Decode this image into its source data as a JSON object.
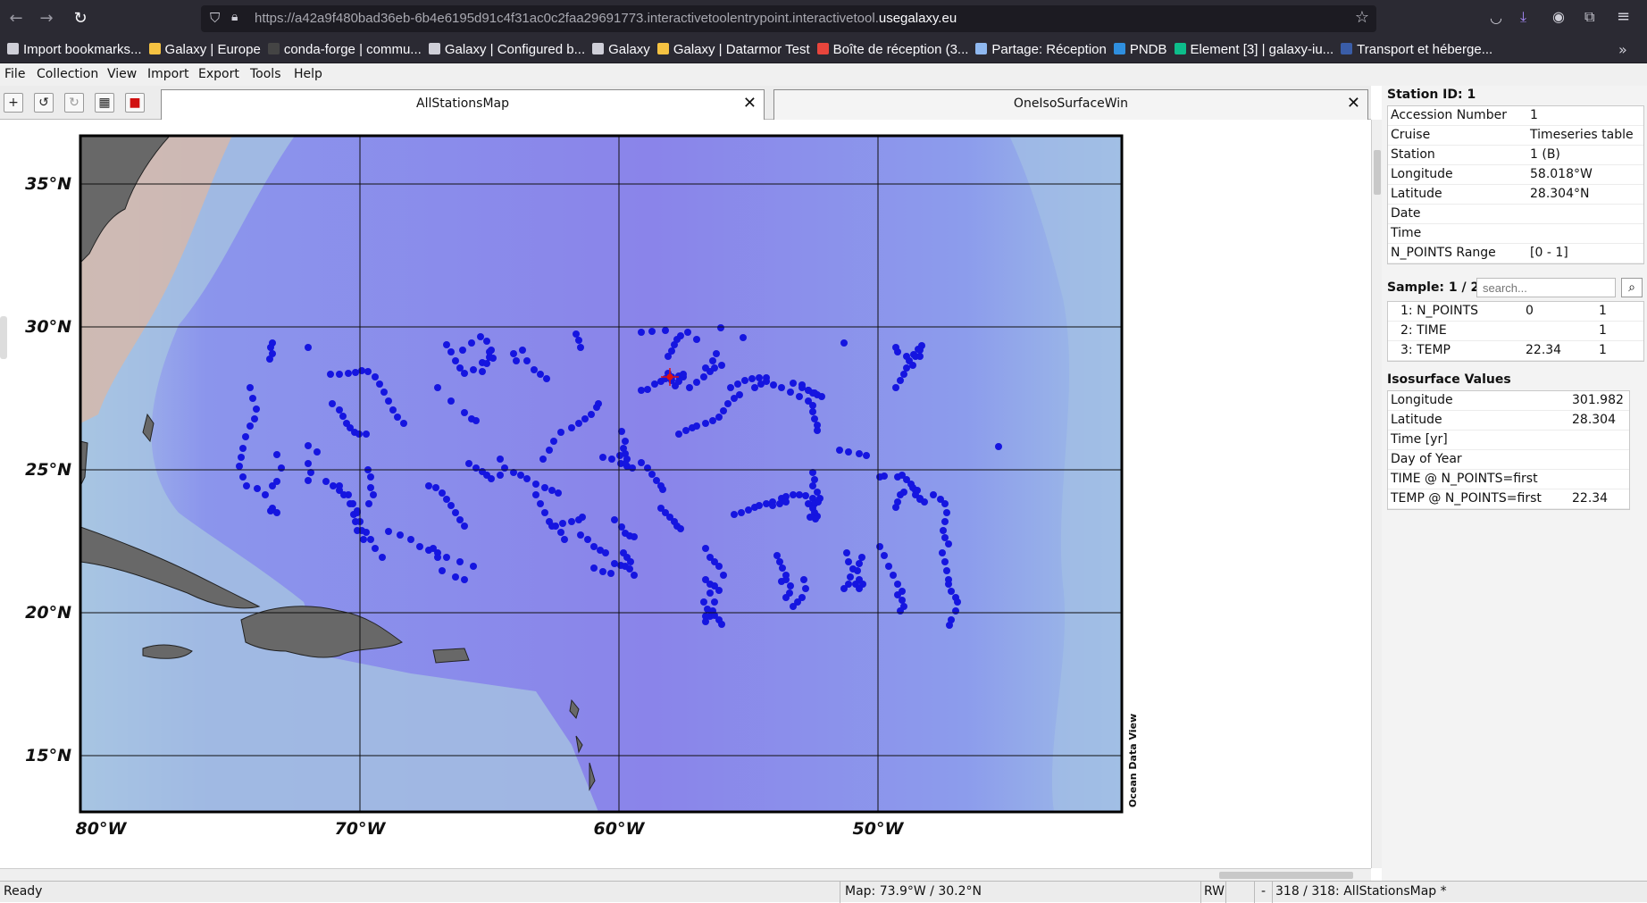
{
  "browser": {
    "url_prefix": "https://a42a9f480bad36eb-6b4e6195d91c4f31ac0c2faa29691773.interactivetoolentrypoint.interactivetool.",
    "url_domain": "usegalaxy.eu",
    "bookmarks": [
      {
        "label": "Import bookmarks...",
        "color": "#cfcfd8"
      },
      {
        "label": "Galaxy | Europe",
        "color": "#f5c242"
      },
      {
        "label": "conda-forge | commu...",
        "color": "#444"
      },
      {
        "label": "Galaxy | Configured b...",
        "color": "#cfcfd8"
      },
      {
        "label": "Galaxy",
        "color": "#cfcfd8"
      },
      {
        "label": "Galaxy | Datarmor Test",
        "color": "#f5c242"
      },
      {
        "label": "Boîte de réception (3...",
        "color": "#e8453c"
      },
      {
        "label": "Partage: Réception",
        "color": "#8fb8f0"
      },
      {
        "label": "PNDB",
        "color": "#2f8fdf"
      },
      {
        "label": "Element [3] | galaxy-iu...",
        "color": "#0dbd8b"
      },
      {
        "label": "Transport et héberge...",
        "color": "#3a5da8"
      }
    ]
  },
  "menu": [
    "File",
    "Collection",
    "View",
    "Import",
    "Export",
    "Tools",
    "Help"
  ],
  "toolbar": {
    "add": "+",
    "undo": "↺",
    "redo": "↻",
    "grid": "▦",
    "save": "■"
  },
  "tabs": [
    {
      "label": "AllStationsMap"
    },
    {
      "label": "OneIsoSurfaceWin"
    }
  ],
  "map": {
    "lat_labels": [
      "35°N",
      "30°N",
      "25°N",
      "20°N",
      "15°N"
    ],
    "lon_labels": [
      "80°W",
      "70°W",
      "60°W",
      "50°W"
    ],
    "watermark": "Ocean Data View",
    "land_color": "#6a6a6a",
    "ocean_color": "#8b8ff0",
    "station_color": "#1515e0",
    "selected_color": "#e01010"
  },
  "station": {
    "title": "Station ID: 1",
    "fields": [
      {
        "k": "Accession Number",
        "v": "1"
      },
      {
        "k": "Cruise",
        "v": "Timeseries table"
      },
      {
        "k": "Station",
        "v": "1 (B)"
      },
      {
        "k": "Longitude",
        "v": "58.018°W"
      },
      {
        "k": "Latitude",
        "v": "28.304°N"
      },
      {
        "k": "Date",
        "v": ""
      },
      {
        "k": "Time",
        "v": ""
      },
      {
        "k": "N_POINTS Range",
        "v": "[0 - 1]"
      }
    ]
  },
  "sample": {
    "title": "Sample: 1 / 2",
    "search_placeholder": "search...",
    "rows": [
      {
        "name": "1: N_POINTS",
        "val": "0",
        "q": "1"
      },
      {
        "name": "2: TIME",
        "val": "",
        "q": "1"
      },
      {
        "name": "3: TEMP",
        "val": "22.34",
        "q": "1"
      }
    ]
  },
  "iso": {
    "title": "Isosurface Values",
    "rows": [
      {
        "k": "Longitude",
        "v": "301.982"
      },
      {
        "k": "Latitude",
        "v": "28.304"
      },
      {
        "k": "Time [yr]",
        "v": ""
      },
      {
        "k": "Day of Year",
        "v": ""
      },
      {
        "k": "TIME @ N_POINTS=first",
        "v": ""
      },
      {
        "k": "TEMP @ N_POINTS=first",
        "v": "22.34"
      }
    ]
  },
  "status": {
    "ready": "Ready",
    "map": "Map:  73.9°W / 30.2°N",
    "rw": "RW",
    "dash": "-",
    "count": "318 / 318: AllStationsMap *"
  }
}
